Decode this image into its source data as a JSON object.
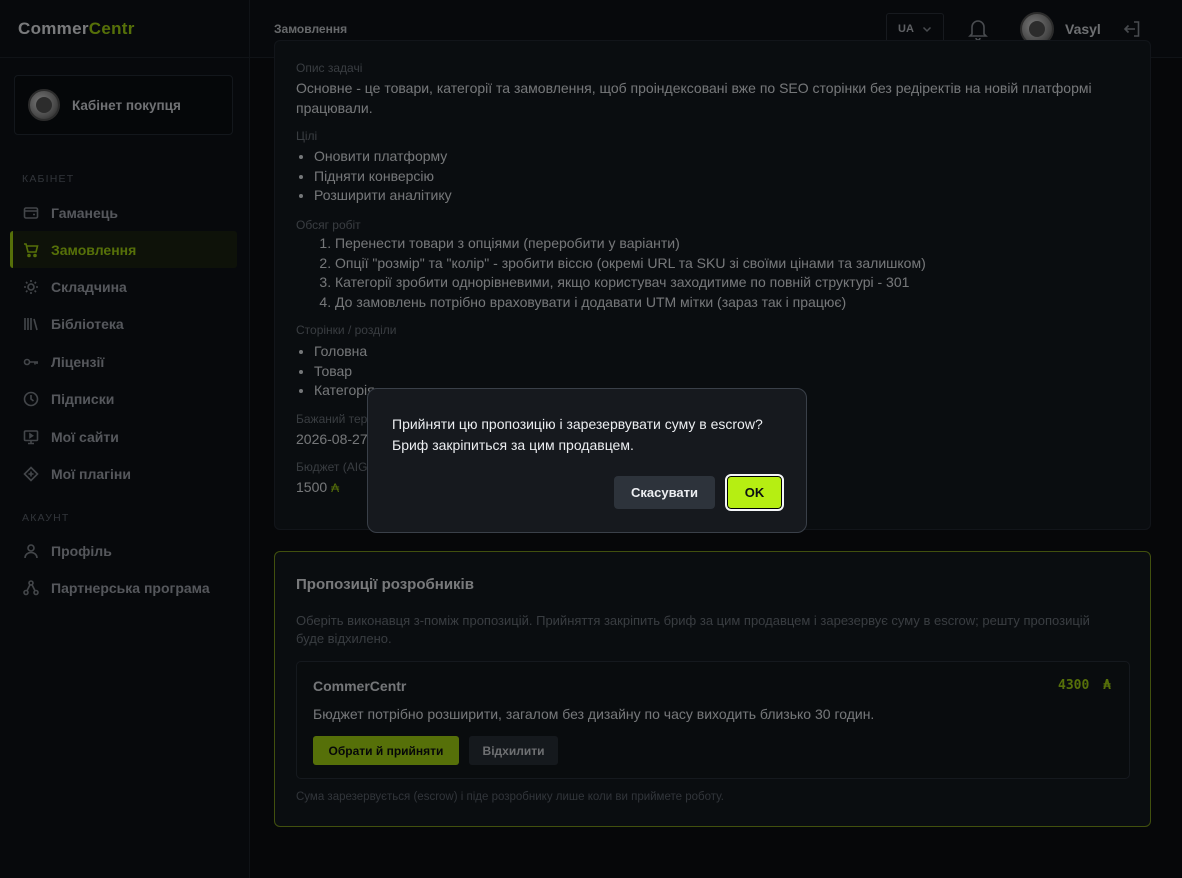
{
  "app": {
    "logo_part1": "Commer",
    "logo_part2": "Centr"
  },
  "sidebar": {
    "cabinet_label": "Кабінет покупця",
    "section_cabinet": "КАБІНЕТ",
    "section_account": "АКАУНТ",
    "items": [
      {
        "label": "Гаманець",
        "icon": "wallet-icon"
      },
      {
        "label": "Замовлення",
        "icon": "cart-icon",
        "active": true
      },
      {
        "label": "Складчина",
        "icon": "sun-icon"
      },
      {
        "label": "Бібліотека",
        "icon": "library-icon"
      },
      {
        "label": "Ліцензії",
        "icon": "key-icon"
      },
      {
        "label": "Підписки",
        "icon": "clock-icon"
      },
      {
        "label": "Мої сайти",
        "icon": "monitor-icon"
      },
      {
        "label": "Мої плагіни",
        "icon": "plugin-icon"
      }
    ],
    "account_items": [
      {
        "label": "Профіль",
        "icon": "user-icon"
      },
      {
        "label": "Партнерська програма",
        "icon": "network-icon"
      }
    ]
  },
  "topbar": {
    "title": "Замовлення",
    "language": "UA",
    "user_name": "Vasyl"
  },
  "brief": {
    "task_label": "Опис задачі",
    "task_value": "Основне - це товари, категорії та замовлення, щоб проіндексовані вже по SEO сторінки без редіректів на новій платформі працювали.",
    "goals_label": "Цілі",
    "goals": [
      "Оновити платформу",
      "Підняти конверсію",
      "Розширити аналітику"
    ],
    "scope_label": "Обсяг робіт",
    "scope": [
      "Перенести товари з опціями (переробити у варіанти)",
      "Опції \"розмір\" та \"колір\" - зробити віссю (окремі URL та SKU зі своїми цінами та залишком)",
      "Категорії зробити однорівневими, якщо користувач заходитиме по повній структурі - 301",
      "До замовлень потрібно враховувати і додавати UTM мітки (зараз так і працює)"
    ],
    "pages_label": "Сторінки / розділи",
    "pages": [
      "Головна",
      "Товар",
      "Категорія"
    ],
    "deadline_label": "Бажаний термін",
    "deadline_value": "2026-08-27",
    "budget_label": "Бюджет (AIGU)",
    "budget_value": "1500",
    "currency_symbol": "₳"
  },
  "proposals": {
    "title": "Пропозиції розробників",
    "description": "Оберіть виконавця з-поміж пропозицій. Прийняття закріпить бриф за цим продавцем і зарезервує суму в escrow; решту пропозицій буде відхилено.",
    "offer": {
      "seller": "CommerCentr",
      "price": "4300",
      "currency_symbol": "₳",
      "text": "Бюджет потрібно розширити, загалом без дизайну по часу виходить близько 30 годин.",
      "accept_label": "Обрати й прийняти",
      "reject_label": "Відхилити"
    },
    "footer": "Сума зарезервується (escrow) і піде розробнику лише коли ви приймете роботу."
  },
  "dialog": {
    "message": "Прийняти цю пропозицію і зарезервувати суму в escrow? Бриф закріпиться за цим продавцем.",
    "cancel_label": "Скасувати",
    "ok_label": "OK"
  },
  "colors": {
    "accent": "#a6d712",
    "background": "#0c0f13",
    "panel": "#151a20"
  }
}
